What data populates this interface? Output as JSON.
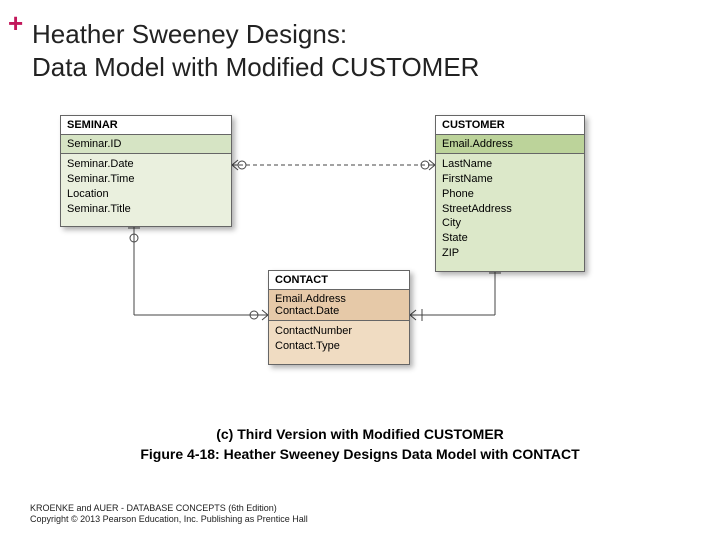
{
  "plus": "+",
  "title_line1": "Heather Sweeney Designs:",
  "title_line2": "Data Model with Modified CUSTOMER",
  "entities": {
    "seminar": {
      "name": "SEMINAR",
      "pk": "Seminar.ID",
      "attrs": [
        "Seminar.Date",
        "Seminar.Time",
        "Location",
        "Seminar.Title"
      ]
    },
    "customer": {
      "name": "CUSTOMER",
      "pk": "Email.Address",
      "attrs": [
        "LastName",
        "FirstName",
        "Phone",
        "StreetAddress",
        "City",
        "State",
        "ZIP"
      ]
    },
    "contact": {
      "name": "CONTACT",
      "pk_lines": [
        "Email.Address",
        "Contact.Date"
      ],
      "attrs": [
        "ContactNumber",
        "Contact.Type"
      ]
    }
  },
  "caption_line1": "(c) Third Version with Modified CUSTOMER",
  "caption_line2": "Figure 4-18:  Heather Sweeney Designs Data Model with CONTACT",
  "footer_line1": "KROENKE and AUER -  DATABASE CONCEPTS (6th Edition)",
  "footer_line2": "Copyright © 2013 Pearson Education, Inc. Publishing as Prentice Hall"
}
